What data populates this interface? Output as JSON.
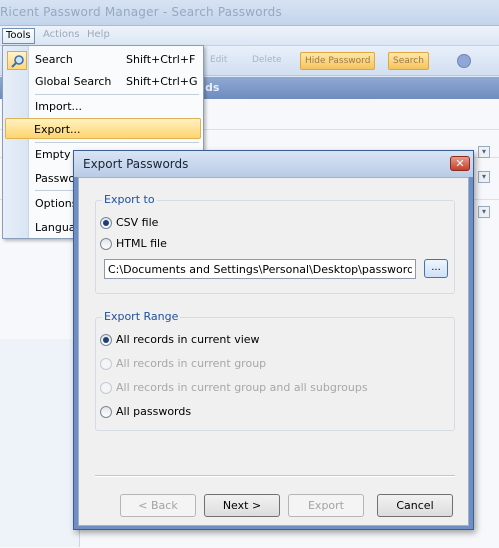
{
  "app": {
    "title": "Ricent Password Manager - Search Passwords",
    "menu": {
      "tools": "Tools",
      "actions": "Actions",
      "help": "Help"
    },
    "toolbar": {
      "edit": "Edit",
      "delete": "Delete",
      "hide_password": "Hide Password",
      "search": "Search"
    },
    "strip_label": "ds"
  },
  "tools_menu": {
    "items": [
      {
        "label": "Search",
        "shortcut": "Shift+Ctrl+F",
        "icon": "search-icon"
      },
      {
        "label": "Global Search",
        "shortcut": "Shift+Ctrl+G"
      },
      {
        "label": "Import..."
      },
      {
        "label": "Export...",
        "highlighted": true
      },
      {
        "label": "Empty Re"
      },
      {
        "label": "Passwor"
      },
      {
        "label": "Options..."
      },
      {
        "label": "Languag"
      }
    ]
  },
  "dialog": {
    "title": "Export Passwords",
    "close_glyph": "✕",
    "export_to": {
      "legend": "Export to",
      "options": [
        {
          "label": "CSV file",
          "checked": true
        },
        {
          "label": "HTML file",
          "checked": false
        }
      ],
      "path_value": "C:\\Documents and Settings\\Personal\\Desktop\\passwords.csv",
      "browse_label": "..."
    },
    "export_range": {
      "legend": "Export Range",
      "options": [
        {
          "label": "All records in current view",
          "checked": true,
          "enabled": true
        },
        {
          "label": "All records in current group",
          "checked": false,
          "enabled": false
        },
        {
          "label": "All records in current group and all subgroups",
          "checked": false,
          "enabled": false
        },
        {
          "label": "All passwords",
          "checked": false,
          "enabled": true
        }
      ]
    },
    "buttons": {
      "back": "< Back",
      "next": "Next >",
      "export": "Export",
      "cancel": "Cancel"
    }
  },
  "colors": {
    "legend_text": "#1f4f9b",
    "menu_highlight": "#ffd46e",
    "dialog_frame": "#6f8fc4"
  }
}
